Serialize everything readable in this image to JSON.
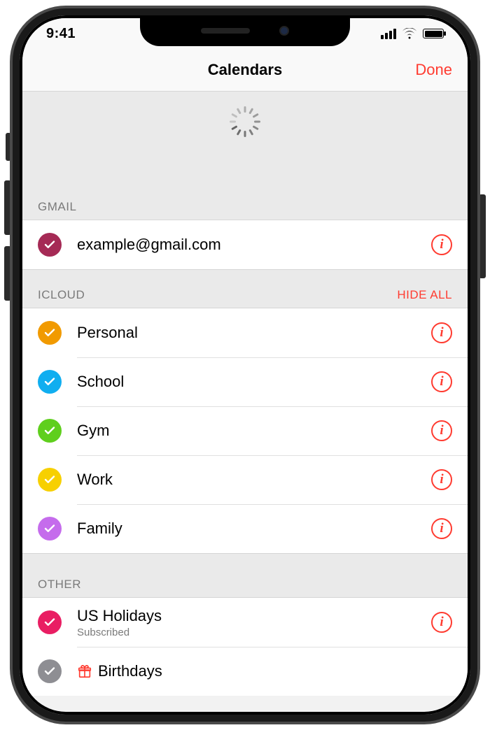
{
  "status": {
    "time": "9:41"
  },
  "nav": {
    "title": "Calendars",
    "done": "Done"
  },
  "sections": {
    "gmail": {
      "header": "GMAIL",
      "items": [
        {
          "label": "example@gmail.com",
          "color": "#a52a55"
        }
      ]
    },
    "icloud": {
      "header": "ICLOUD",
      "action": "HIDE ALL",
      "items": [
        {
          "label": "Personal",
          "color": "#f19a00"
        },
        {
          "label": "School",
          "color": "#10aef0"
        },
        {
          "label": "Gym",
          "color": "#5fcf1d"
        },
        {
          "label": "Work",
          "color": "#f7d000"
        },
        {
          "label": "Family",
          "color": "#c56cec"
        }
      ]
    },
    "other": {
      "header": "OTHER",
      "items": [
        {
          "label": "US Holidays",
          "sub": "Subscribed",
          "color": "#e91e63"
        },
        {
          "label": "Birthdays",
          "color": "#8e8e93",
          "icon": "gift"
        }
      ]
    }
  }
}
